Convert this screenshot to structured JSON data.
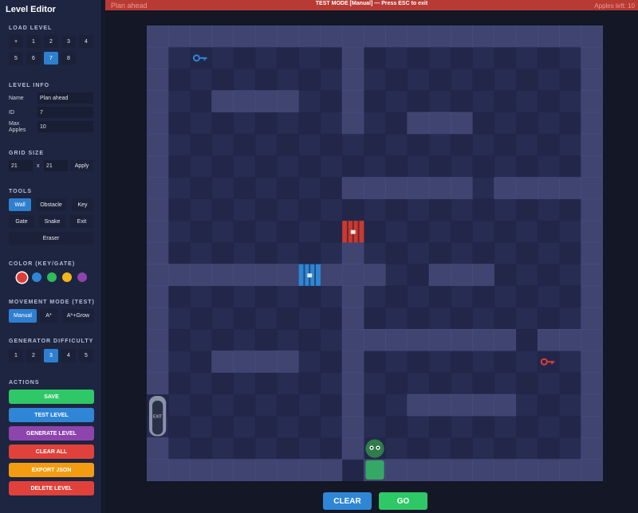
{
  "sidebar": {
    "title": "Level Editor",
    "load_level": {
      "title": "LOAD LEVEL",
      "buttons": [
        "+",
        "1",
        "2",
        "3",
        "4",
        "5",
        "6",
        "7",
        "8"
      ],
      "active": "7"
    },
    "level_info": {
      "title": "LEVEL INFO",
      "name_label": "Name",
      "name_value": "Plan ahead",
      "id_label": "ID",
      "id_value": "7",
      "apples_label": "Max Apples",
      "apples_value": "10"
    },
    "grid_size": {
      "title": "GRID SIZE",
      "width": "21",
      "height": "21",
      "separator": "x",
      "apply_label": "Apply"
    },
    "tools": {
      "title": "TOOLS",
      "items": [
        "Wall",
        "Obstacle",
        "Key",
        "Gate",
        "Snake",
        "Exit",
        "Eraser"
      ],
      "active": "Wall"
    },
    "color": {
      "title": "COLOR (KEY/GATE)",
      "swatches": [
        "#e03c36",
        "#2f86d6",
        "#2dbb5b",
        "#f2b51d",
        "#8e44ad"
      ],
      "selected": 0
    },
    "movement": {
      "title": "MOVEMENT MODE (TEST)",
      "items": [
        "Manual",
        "A*",
        "A*+Grow"
      ],
      "active": "Manual"
    },
    "generator": {
      "title": "GENERATOR DIFFICULTY",
      "items": [
        "1",
        "2",
        "3",
        "4",
        "5"
      ],
      "active": "3"
    },
    "actions": {
      "title": "ACTIONS",
      "items": [
        {
          "label": "SAVE",
          "color": "#2ec866"
        },
        {
          "label": "TEST LEVEL",
          "color": "#2f86d6"
        },
        {
          "label": "GENERATE LEVEL",
          "color": "#8e44ad"
        },
        {
          "label": "CLEAR ALL",
          "color": "#e0413a"
        },
        {
          "label": "EXPORT JSON",
          "color": "#f39c12"
        },
        {
          "label": "DELETE LEVEL",
          "color": "#e0413a"
        }
      ]
    }
  },
  "banner": {
    "left": "Plan ahead",
    "center": "TEST MODE [Manual] — Press ESC to exit",
    "right": "Apples left: 10"
  },
  "board": {
    "cols": 21,
    "rows": 21,
    "colors": {
      "floor_a": "#22274a",
      "floor_b": "#262c52",
      "wall": "#3f4470",
      "wall_hi": "#4a5080"
    },
    "walls": [
      [
        0,
        0,
        21,
        1
      ],
      [
        0,
        20,
        21,
        1
      ],
      [
        0,
        1,
        1,
        19
      ],
      [
        20,
        1,
        1,
        19
      ],
      [
        9,
        1,
        1,
        4
      ],
      [
        3,
        3,
        4,
        1
      ],
      [
        12,
        4,
        3,
        1
      ],
      [
        9,
        7,
        6,
        1
      ],
      [
        16,
        7,
        4,
        1
      ],
      [
        9,
        10,
        1,
        4
      ],
      [
        1,
        11,
        6,
        1
      ],
      [
        8,
        11,
        3,
        1
      ],
      [
        13,
        11,
        3,
        1
      ],
      [
        9,
        14,
        1,
        6
      ],
      [
        9,
        14,
        8,
        1
      ],
      [
        18,
        14,
        2,
        1
      ],
      [
        3,
        15,
        4,
        1
      ],
      [
        12,
        17,
        5,
        1
      ],
      [
        10,
        20,
        10,
        1
      ]
    ],
    "gaps": [
      [
        0,
        17,
        1,
        2
      ],
      [
        9,
        20,
        1,
        1
      ],
      [
        9,
        9,
        1,
        1
      ],
      [
        7,
        11,
        1,
        1
      ]
    ],
    "gates": [
      {
        "col": 9,
        "row": 9,
        "color": "#c93a31"
      },
      {
        "col": 7,
        "row": 11,
        "color": "#2f86d6"
      }
    ],
    "keys": [
      {
        "col": 2,
        "row": 1,
        "color": "#2f86d6"
      },
      {
        "col": 18,
        "row": 15,
        "color": "#e03c36"
      }
    ],
    "exit": {
      "col": 0,
      "row": 17,
      "label": "EXIT"
    },
    "snake": {
      "head": [
        10,
        19
      ],
      "body": [
        [
          10,
          20
        ]
      ],
      "head_color": "#2e7d4a",
      "body_color": "#35a866"
    }
  },
  "controls": {
    "clear_label": "CLEAR",
    "go_label": "GO"
  }
}
